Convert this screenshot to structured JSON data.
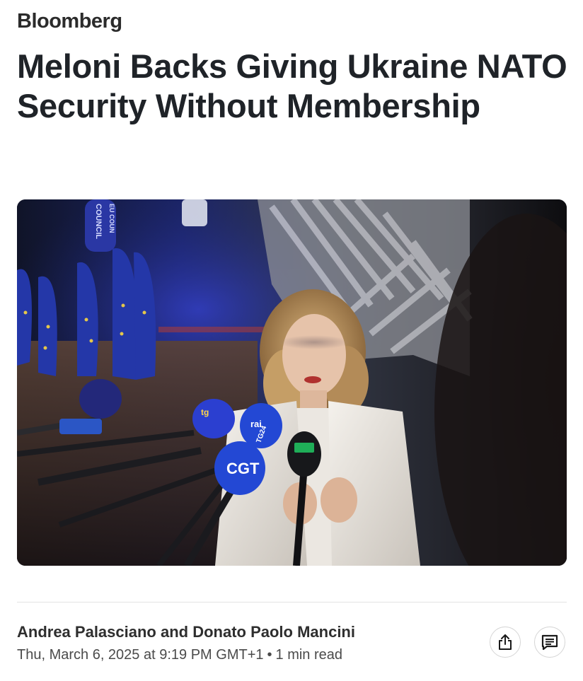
{
  "brand": {
    "name": "Bloomberg"
  },
  "article": {
    "headline": "Meloni Backs Giving Ukraine NATO Security Without Membership",
    "authors": "Andrea Palasciano and Donato Paolo Mancini",
    "date": "Thu, March 6, 2025 at 9:19 PM GMT+1",
    "separator": "•",
    "read_time": "1 min read"
  },
  "photo": {
    "mic_label_council": "COUNCIL",
    "mic_label_eu_council": "EU COUN",
    "mic_label_rai": "rai",
    "mic_label_cgt": "CGT",
    "mic_label_tg": "tg",
    "mic_label_tg24": "TG24"
  },
  "actions": {
    "share_icon": "share-icon",
    "comment_icon": "comment-icon"
  },
  "colors": {
    "headline": "#1f2328",
    "eu_flag_blue": "#2437a8",
    "mic_blue": "#2348d4",
    "mic_green": "#1fae58"
  }
}
